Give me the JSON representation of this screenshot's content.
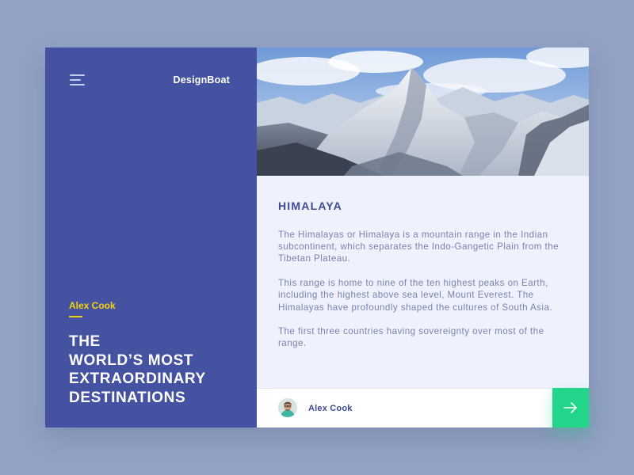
{
  "sidebar": {
    "brand": "DesignBoat",
    "menu_icon": "hamburger-menu-icon",
    "author": "Alex Cook",
    "headline": [
      "THE",
      "WORLD’S MOST",
      "EXTRAORDINARY",
      "DESTINATIONS"
    ],
    "accent_color": "#f5d312",
    "background_color": "#4552a1"
  },
  "article": {
    "title": "HIMALAYA",
    "paragraphs": [
      "The Himalayas or Himalaya is a mountain range in the Indian subcontinent, which separates the Indo-Gangetic Plain from the Tibetan Plateau.",
      "This range is home to nine of the ten highest peaks on Earth, including the highest above sea level, Mount Everest. The Himalayas have profoundly shaped the cultures of South Asia.",
      "The first three countries having sovereignty over most of the range."
    ],
    "hero_image": "snowy-mountain-range-photo"
  },
  "footer": {
    "author": "Alex Cook",
    "next_icon": "arrow-right-icon",
    "button_color": "#22d58a"
  }
}
